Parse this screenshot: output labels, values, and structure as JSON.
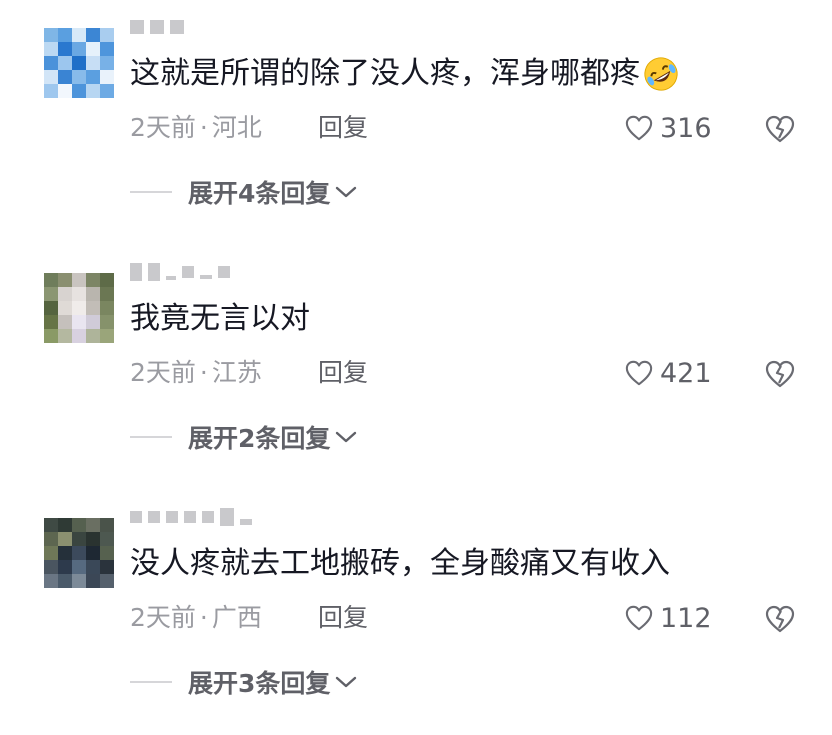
{
  "comments": [
    {
      "text": "这就是所谓的除了没人疼，浑身哪都疼",
      "emoji_icon": "rolling-on-floor-laughing-emoji",
      "time": "2天前",
      "dot": "·",
      "location": "河北",
      "reply_label": "回复",
      "likes": "316",
      "expand_label": "展开4条回复"
    },
    {
      "text": "我竟无言以对",
      "time": "2天前",
      "dot": "·",
      "location": "江苏",
      "reply_label": "回复",
      "likes": "421",
      "expand_label": "展开2条回复"
    },
    {
      "text": "没人疼就去工地搬砖，全身酸痛又有收入",
      "time": "2天前",
      "dot": "·",
      "location": "广西",
      "reply_label": "回复",
      "likes": "112",
      "expand_label": "展开3条回复"
    }
  ],
  "icons": {
    "like": "heart-outline-icon",
    "dislike": "broken-heart-icon",
    "expand": "chevron-down-icon"
  },
  "colors": {
    "text": "#161823",
    "meta": "#9a9ba1",
    "action": "#5f6067"
  }
}
